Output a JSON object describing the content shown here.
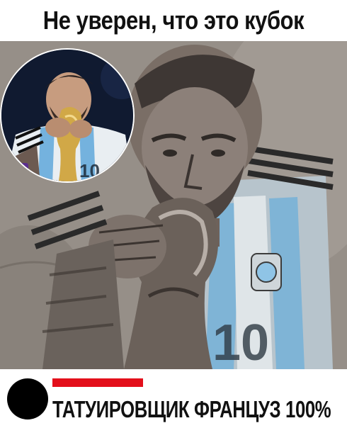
{
  "meme": {
    "top_caption": "Не уверен, что это кубок",
    "bottom_caption": "ТАТУИРОВЩИК ФРАНЦУЗ 100%"
  },
  "colors": {
    "accent_bar": "#e30f1b",
    "dot": "#000000",
    "jersey_blue": "#8fc4e6",
    "trophy_gold": "#c9a24a"
  }
}
